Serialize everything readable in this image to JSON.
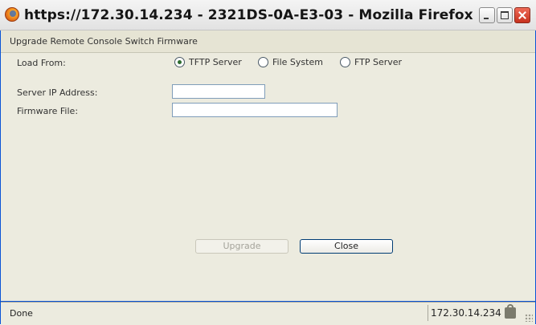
{
  "window": {
    "title": "https://172.30.14.234 - 2321DS-0A-E3-03 - Mozilla Firefox"
  },
  "dialog": {
    "heading": "Upgrade Remote Console Switch Firmware",
    "load_from_label": "Load From:",
    "load_options": [
      "TFTP Server",
      "File System",
      "FTP Server"
    ],
    "selected_option": "TFTP Server",
    "server_ip_label": "Server IP Address:",
    "server_ip_value": "",
    "firmware_file_label": "Firmware File:",
    "firmware_file_value": "",
    "upgrade_label": "Upgrade",
    "close_label": "Close"
  },
  "statusbar": {
    "status": "Done",
    "address": "172.30.14.234"
  },
  "colors": {
    "accent": "#0a54d6",
    "dialog_bg": "#ecebdf"
  },
  "icons": [
    "firefox-icon",
    "minimize-icon",
    "maximize-icon",
    "close-icon",
    "lock-icon",
    "resize-grip-icon"
  ]
}
